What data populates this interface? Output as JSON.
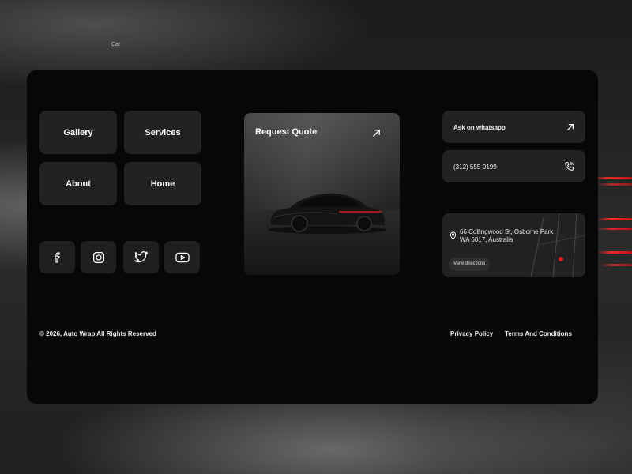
{
  "background": {
    "label": "Car"
  },
  "nav": {
    "gallery": "Gallery",
    "services": "Services",
    "about": "About",
    "home": "Home"
  },
  "social": [
    "facebook-icon",
    "instagram-icon",
    "twitter-icon",
    "youtube-icon"
  ],
  "feature": {
    "title": "Request Quote",
    "icon": "arrow-up-right-icon"
  },
  "contact": {
    "whatsapp_label": "Ask on whatsapp",
    "phone": "(312) 555-0199",
    "address_line1": "66 Collingwood St, Osborne Park",
    "address_line2": "WA 6017, Australia",
    "directions_label": "View directions"
  },
  "footer": {
    "copyright": "© 2026, Auto Wrap  All Rights Reserved",
    "privacy": "Privacy Policy",
    "terms": "Terms And Conditions"
  },
  "colors": {
    "card": "#070707",
    "tile": "#222223",
    "accent": "#e01b1b"
  }
}
